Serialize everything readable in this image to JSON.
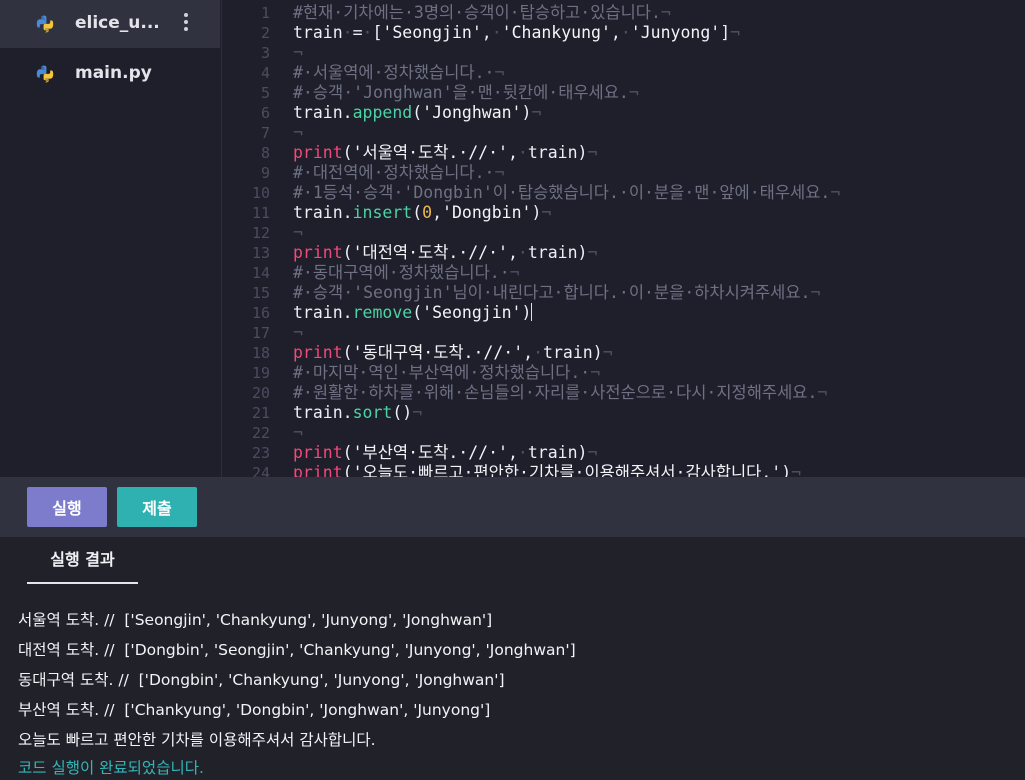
{
  "sidebar": {
    "files": [
      {
        "name": "elice_u...",
        "active": true,
        "icon": "python-icon"
      },
      {
        "name": "main.py",
        "active": false,
        "icon": "python-icon"
      }
    ]
  },
  "editor": {
    "lines": [
      {
        "n": "1",
        "tokens": [
          [
            "cmt",
            "#현재·기차에는·3명의·승객이·탑승하고·있습니다."
          ],
          [
            "ws",
            "¬"
          ]
        ]
      },
      {
        "n": "2",
        "tokens": [
          [
            "id",
            "train"
          ],
          [
            "ws",
            "·"
          ],
          [
            "pun",
            "="
          ],
          [
            "ws",
            "·"
          ],
          [
            "pun",
            "["
          ],
          [
            "str",
            "'Seongjin'"
          ],
          [
            "pun",
            ","
          ],
          [
            "ws",
            "·"
          ],
          [
            "str",
            "'Chankyung'"
          ],
          [
            "pun",
            ","
          ],
          [
            "ws",
            "·"
          ],
          [
            "str",
            "'Junyong'"
          ],
          [
            "pun",
            "]"
          ],
          [
            "ws",
            "¬"
          ]
        ]
      },
      {
        "n": "3",
        "tokens": [
          [
            "ws",
            "¬"
          ]
        ]
      },
      {
        "n": "4",
        "tokens": [
          [
            "cmt",
            "#·서울역에·정차했습니다.·"
          ],
          [
            "ws",
            "¬"
          ]
        ]
      },
      {
        "n": "5",
        "tokens": [
          [
            "cmt",
            "#·승객·'Jonghwan'을·맨·뒷칸에·태우세요."
          ],
          [
            "ws",
            "¬"
          ]
        ]
      },
      {
        "n": "6",
        "tokens": [
          [
            "id",
            "train"
          ],
          [
            "pun",
            "."
          ],
          [
            "fn",
            "append"
          ],
          [
            "pun",
            "("
          ],
          [
            "str",
            "'Jonghwan'"
          ],
          [
            "pun",
            ")"
          ],
          [
            "ws",
            "¬"
          ]
        ]
      },
      {
        "n": "7",
        "tokens": [
          [
            "ws",
            "¬"
          ]
        ]
      },
      {
        "n": "8",
        "tokens": [
          [
            "kw",
            "print"
          ],
          [
            "pun",
            "("
          ],
          [
            "str",
            "'서울역·도착.·//·'"
          ],
          [
            "pun",
            ","
          ],
          [
            "ws",
            "·"
          ],
          [
            "id",
            "train"
          ],
          [
            "pun",
            ")"
          ],
          [
            "ws",
            "¬"
          ]
        ]
      },
      {
        "n": "9",
        "tokens": [
          [
            "cmt",
            "#·대전역에·정차했습니다.·"
          ],
          [
            "ws",
            "¬"
          ]
        ]
      },
      {
        "n": "10",
        "tokens": [
          [
            "cmt",
            "#·1등석·승객·'Dongbin'이·탑승했습니다.·이·분을·맨·앞에·태우세요."
          ],
          [
            "ws",
            "¬"
          ]
        ]
      },
      {
        "n": "11",
        "tokens": [
          [
            "id",
            "train"
          ],
          [
            "pun",
            "."
          ],
          [
            "fn",
            "insert"
          ],
          [
            "pun",
            "("
          ],
          [
            "num",
            "0"
          ],
          [
            "pun",
            ","
          ],
          [
            "str",
            "'Dongbin'"
          ],
          [
            "pun",
            ")"
          ],
          [
            "ws",
            "¬"
          ]
        ]
      },
      {
        "n": "12",
        "tokens": [
          [
            "ws",
            "¬"
          ]
        ]
      },
      {
        "n": "13",
        "tokens": [
          [
            "kw",
            "print"
          ],
          [
            "pun",
            "("
          ],
          [
            "str",
            "'대전역·도착.·//·'"
          ],
          [
            "pun",
            ","
          ],
          [
            "ws",
            "·"
          ],
          [
            "id",
            "train"
          ],
          [
            "pun",
            ")"
          ],
          [
            "ws",
            "¬"
          ]
        ]
      },
      {
        "n": "14",
        "tokens": [
          [
            "cmt",
            "#·동대구역에·정차했습니다.·"
          ],
          [
            "ws",
            "¬"
          ]
        ]
      },
      {
        "n": "15",
        "tokens": [
          [
            "cmt",
            "#·승객·'Seongjin'님이·내린다고·합니다.·이·분을·하차시켜주세요."
          ],
          [
            "ws",
            "¬"
          ]
        ]
      },
      {
        "n": "16",
        "tokens": [
          [
            "id",
            "train"
          ],
          [
            "pun",
            "."
          ],
          [
            "fn",
            "remove"
          ],
          [
            "pun",
            "("
          ],
          [
            "str",
            "'Seongjin'"
          ],
          [
            "pun",
            ")"
          ],
          [
            "cursor",
            ""
          ]
        ]
      },
      {
        "n": "17",
        "tokens": [
          [
            "ws",
            "¬"
          ]
        ]
      },
      {
        "n": "18",
        "tokens": [
          [
            "kw",
            "print"
          ],
          [
            "pun",
            "("
          ],
          [
            "str",
            "'동대구역·도착.·//·'"
          ],
          [
            "pun",
            ","
          ],
          [
            "ws",
            "·"
          ],
          [
            "id",
            "train"
          ],
          [
            "pun",
            ")"
          ],
          [
            "ws",
            "¬"
          ]
        ]
      },
      {
        "n": "19",
        "tokens": [
          [
            "cmt",
            "#·마지막·역인·부산역에·정차했습니다.·"
          ],
          [
            "ws",
            "¬"
          ]
        ]
      },
      {
        "n": "20",
        "tokens": [
          [
            "cmt",
            "#·원활한·하차를·위해·손님들의·자리를·사전순으로·다시·지정해주세요."
          ],
          [
            "ws",
            "¬"
          ]
        ]
      },
      {
        "n": "21",
        "tokens": [
          [
            "id",
            "train"
          ],
          [
            "pun",
            "."
          ],
          [
            "fn",
            "sort"
          ],
          [
            "pun",
            "()"
          ],
          [
            "ws",
            "¬"
          ]
        ]
      },
      {
        "n": "22",
        "tokens": [
          [
            "ws",
            "¬"
          ]
        ]
      },
      {
        "n": "23",
        "tokens": [
          [
            "kw",
            "print"
          ],
          [
            "pun",
            "("
          ],
          [
            "str",
            "'부산역·도착.·//·'"
          ],
          [
            "pun",
            ","
          ],
          [
            "ws",
            "·"
          ],
          [
            "id",
            "train"
          ],
          [
            "pun",
            ")"
          ],
          [
            "ws",
            "¬"
          ]
        ]
      },
      {
        "n": "24",
        "tokens": [
          [
            "kw",
            "print"
          ],
          [
            "pun",
            "("
          ],
          [
            "str",
            "'오늘도·빠르고·편안한·기차를·이용해주셔서·감사합니다.'"
          ],
          [
            "pun",
            ")"
          ],
          [
            "ws",
            "¬"
          ]
        ]
      }
    ]
  },
  "toolbar": {
    "run_label": "실행",
    "submit_label": "제출",
    "colors": {
      "run": "#7d7ccc",
      "submit": "#2fb1b2"
    }
  },
  "output": {
    "tab_label": "실행 결과",
    "lines": [
      "서울역 도착. //  ['Seongjin', 'Chankyung', 'Junyong', 'Jonghwan']",
      "대전역 도착. //  ['Dongbin', 'Seongjin', 'Chankyung', 'Junyong', 'Jonghwan']",
      "동대구역 도착. //  ['Dongbin', 'Chankyung', 'Junyong', 'Jonghwan']",
      "부산역 도착. //  ['Chankyung', 'Dongbin', 'Jonghwan', 'Junyong']",
      "오늘도 빠르고 편안한 기차를 이용해주셔서 감사합니다."
    ],
    "status": "코드 실행이 완료되었습니다."
  }
}
